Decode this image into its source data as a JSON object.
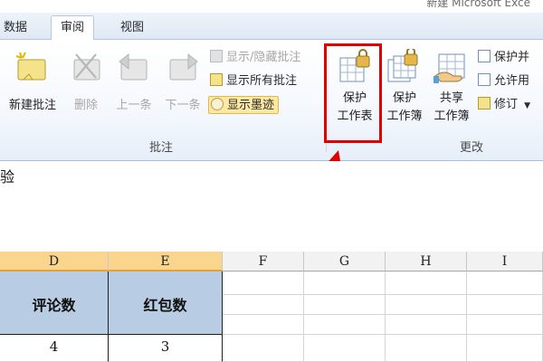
{
  "window": {
    "title": "新建 Microsoft Exce"
  },
  "tabs": [
    {
      "label": "数据",
      "active": false
    },
    {
      "label": "审阅",
      "active": true
    },
    {
      "label": "视图",
      "active": false
    }
  ],
  "ribbon": {
    "comments_group": {
      "label": "批注",
      "new_comment": "新建批注",
      "delete": "删除",
      "previous": "上一条",
      "next": "下一条",
      "show_hide_comment": "显示/隐藏批注",
      "show_all_comments": "显示所有批注",
      "show_ink": "显示墨迹"
    },
    "changes_group": {
      "label": "更改",
      "protect_sheet_line1": "保护",
      "protect_sheet_line2": "工作表",
      "protect_workbook_line1": "保护",
      "protect_workbook_line2": "工作簿",
      "share_workbook_line1": "共享",
      "share_workbook_line2": "工作簿",
      "protect_and_share": "保护并",
      "allow_users": "允许用",
      "track_changes": "修订"
    }
  },
  "content": {
    "text": "验"
  },
  "sheet": {
    "columns": [
      "D",
      "E",
      "F",
      "G",
      "H",
      "I"
    ],
    "headers": {
      "D": "评论数",
      "E": "红包数"
    },
    "row_values": {
      "D": "4",
      "E": "3"
    }
  },
  "colors": {
    "highlight": "#e00000",
    "header_cell_bg": "#b8cce4",
    "selected_col_bg": "#f9d58d"
  }
}
